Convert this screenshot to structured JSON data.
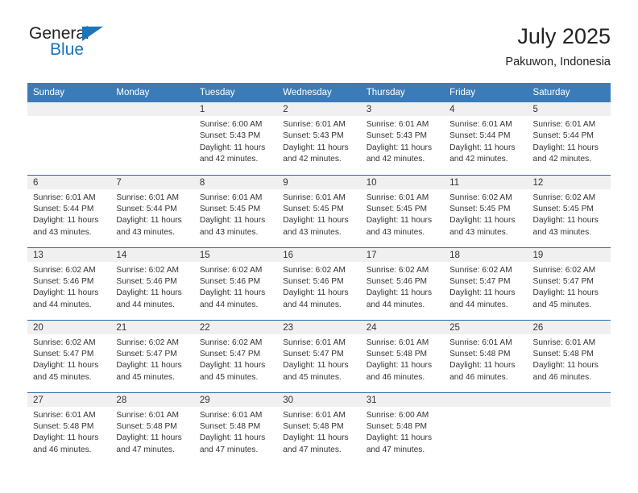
{
  "brand": {
    "name_top": "General",
    "name_bottom": "Blue",
    "accent_color": "#1b75bb"
  },
  "header": {
    "title": "July 2025",
    "subtitle": "Pakuwon, Indonesia"
  },
  "theme": {
    "header_bg": "#3b7cb8",
    "daynum_bg": "#f0f0f0",
    "rule_color": "#2b6ca8",
    "text_color": "#333333"
  },
  "weekday_headers": [
    "Sunday",
    "Monday",
    "Tuesday",
    "Wednesday",
    "Thursday",
    "Friday",
    "Saturday"
  ],
  "weeks": [
    [
      {
        "day": "",
        "sunrise": "",
        "sunset": "",
        "daylight_line1": "",
        "daylight_line2": ""
      },
      {
        "day": "",
        "sunrise": "",
        "sunset": "",
        "daylight_line1": "",
        "daylight_line2": ""
      },
      {
        "day": "1",
        "sunrise": "Sunrise: 6:00 AM",
        "sunset": "Sunset: 5:43 PM",
        "daylight_line1": "Daylight: 11 hours",
        "daylight_line2": "and 42 minutes."
      },
      {
        "day": "2",
        "sunrise": "Sunrise: 6:01 AM",
        "sunset": "Sunset: 5:43 PM",
        "daylight_line1": "Daylight: 11 hours",
        "daylight_line2": "and 42 minutes."
      },
      {
        "day": "3",
        "sunrise": "Sunrise: 6:01 AM",
        "sunset": "Sunset: 5:43 PM",
        "daylight_line1": "Daylight: 11 hours",
        "daylight_line2": "and 42 minutes."
      },
      {
        "day": "4",
        "sunrise": "Sunrise: 6:01 AM",
        "sunset": "Sunset: 5:44 PM",
        "daylight_line1": "Daylight: 11 hours",
        "daylight_line2": "and 42 minutes."
      },
      {
        "day": "5",
        "sunrise": "Sunrise: 6:01 AM",
        "sunset": "Sunset: 5:44 PM",
        "daylight_line1": "Daylight: 11 hours",
        "daylight_line2": "and 42 minutes."
      }
    ],
    [
      {
        "day": "6",
        "sunrise": "Sunrise: 6:01 AM",
        "sunset": "Sunset: 5:44 PM",
        "daylight_line1": "Daylight: 11 hours",
        "daylight_line2": "and 43 minutes."
      },
      {
        "day": "7",
        "sunrise": "Sunrise: 6:01 AM",
        "sunset": "Sunset: 5:44 PM",
        "daylight_line1": "Daylight: 11 hours",
        "daylight_line2": "and 43 minutes."
      },
      {
        "day": "8",
        "sunrise": "Sunrise: 6:01 AM",
        "sunset": "Sunset: 5:45 PM",
        "daylight_line1": "Daylight: 11 hours",
        "daylight_line2": "and 43 minutes."
      },
      {
        "day": "9",
        "sunrise": "Sunrise: 6:01 AM",
        "sunset": "Sunset: 5:45 PM",
        "daylight_line1": "Daylight: 11 hours",
        "daylight_line2": "and 43 minutes."
      },
      {
        "day": "10",
        "sunrise": "Sunrise: 6:01 AM",
        "sunset": "Sunset: 5:45 PM",
        "daylight_line1": "Daylight: 11 hours",
        "daylight_line2": "and 43 minutes."
      },
      {
        "day": "11",
        "sunrise": "Sunrise: 6:02 AM",
        "sunset": "Sunset: 5:45 PM",
        "daylight_line1": "Daylight: 11 hours",
        "daylight_line2": "and 43 minutes."
      },
      {
        "day": "12",
        "sunrise": "Sunrise: 6:02 AM",
        "sunset": "Sunset: 5:45 PM",
        "daylight_line1": "Daylight: 11 hours",
        "daylight_line2": "and 43 minutes."
      }
    ],
    [
      {
        "day": "13",
        "sunrise": "Sunrise: 6:02 AM",
        "sunset": "Sunset: 5:46 PM",
        "daylight_line1": "Daylight: 11 hours",
        "daylight_line2": "and 44 minutes."
      },
      {
        "day": "14",
        "sunrise": "Sunrise: 6:02 AM",
        "sunset": "Sunset: 5:46 PM",
        "daylight_line1": "Daylight: 11 hours",
        "daylight_line2": "and 44 minutes."
      },
      {
        "day": "15",
        "sunrise": "Sunrise: 6:02 AM",
        "sunset": "Sunset: 5:46 PM",
        "daylight_line1": "Daylight: 11 hours",
        "daylight_line2": "and 44 minutes."
      },
      {
        "day": "16",
        "sunrise": "Sunrise: 6:02 AM",
        "sunset": "Sunset: 5:46 PM",
        "daylight_line1": "Daylight: 11 hours",
        "daylight_line2": "and 44 minutes."
      },
      {
        "day": "17",
        "sunrise": "Sunrise: 6:02 AM",
        "sunset": "Sunset: 5:46 PM",
        "daylight_line1": "Daylight: 11 hours",
        "daylight_line2": "and 44 minutes."
      },
      {
        "day": "18",
        "sunrise": "Sunrise: 6:02 AM",
        "sunset": "Sunset: 5:47 PM",
        "daylight_line1": "Daylight: 11 hours",
        "daylight_line2": "and 44 minutes."
      },
      {
        "day": "19",
        "sunrise": "Sunrise: 6:02 AM",
        "sunset": "Sunset: 5:47 PM",
        "daylight_line1": "Daylight: 11 hours",
        "daylight_line2": "and 45 minutes."
      }
    ],
    [
      {
        "day": "20",
        "sunrise": "Sunrise: 6:02 AM",
        "sunset": "Sunset: 5:47 PM",
        "daylight_line1": "Daylight: 11 hours",
        "daylight_line2": "and 45 minutes."
      },
      {
        "day": "21",
        "sunrise": "Sunrise: 6:02 AM",
        "sunset": "Sunset: 5:47 PM",
        "daylight_line1": "Daylight: 11 hours",
        "daylight_line2": "and 45 minutes."
      },
      {
        "day": "22",
        "sunrise": "Sunrise: 6:02 AM",
        "sunset": "Sunset: 5:47 PM",
        "daylight_line1": "Daylight: 11 hours",
        "daylight_line2": "and 45 minutes."
      },
      {
        "day": "23",
        "sunrise": "Sunrise: 6:01 AM",
        "sunset": "Sunset: 5:47 PM",
        "daylight_line1": "Daylight: 11 hours",
        "daylight_line2": "and 45 minutes."
      },
      {
        "day": "24",
        "sunrise": "Sunrise: 6:01 AM",
        "sunset": "Sunset: 5:48 PM",
        "daylight_line1": "Daylight: 11 hours",
        "daylight_line2": "and 46 minutes."
      },
      {
        "day": "25",
        "sunrise": "Sunrise: 6:01 AM",
        "sunset": "Sunset: 5:48 PM",
        "daylight_line1": "Daylight: 11 hours",
        "daylight_line2": "and 46 minutes."
      },
      {
        "day": "26",
        "sunrise": "Sunrise: 6:01 AM",
        "sunset": "Sunset: 5:48 PM",
        "daylight_line1": "Daylight: 11 hours",
        "daylight_line2": "and 46 minutes."
      }
    ],
    [
      {
        "day": "27",
        "sunrise": "Sunrise: 6:01 AM",
        "sunset": "Sunset: 5:48 PM",
        "daylight_line1": "Daylight: 11 hours",
        "daylight_line2": "and 46 minutes."
      },
      {
        "day": "28",
        "sunrise": "Sunrise: 6:01 AM",
        "sunset": "Sunset: 5:48 PM",
        "daylight_line1": "Daylight: 11 hours",
        "daylight_line2": "and 47 minutes."
      },
      {
        "day": "29",
        "sunrise": "Sunrise: 6:01 AM",
        "sunset": "Sunset: 5:48 PM",
        "daylight_line1": "Daylight: 11 hours",
        "daylight_line2": "and 47 minutes."
      },
      {
        "day": "30",
        "sunrise": "Sunrise: 6:01 AM",
        "sunset": "Sunset: 5:48 PM",
        "daylight_line1": "Daylight: 11 hours",
        "daylight_line2": "and 47 minutes."
      },
      {
        "day": "31",
        "sunrise": "Sunrise: 6:00 AM",
        "sunset": "Sunset: 5:48 PM",
        "daylight_line1": "Daylight: 11 hours",
        "daylight_line2": "and 47 minutes."
      },
      {
        "day": "",
        "sunrise": "",
        "sunset": "",
        "daylight_line1": "",
        "daylight_line2": ""
      },
      {
        "day": "",
        "sunrise": "",
        "sunset": "",
        "daylight_line1": "",
        "daylight_line2": ""
      }
    ]
  ]
}
